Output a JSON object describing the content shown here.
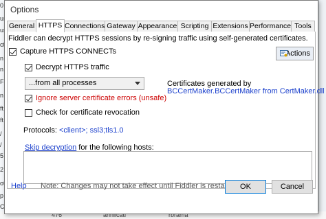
{
  "background": {
    "left_fragments": [
      "0",
      "us",
      "us",
      "ct",
      "n",
      "n",
      "Fu",
      "n",
      "ft",
      "ft",
      "/",
      "/",
      "5",
      "2",
      "ot",
      "p",
      "C"
    ],
    "bottom_fragments": [
      "",
      "476",
      "annlicati",
      "rbrama"
    ]
  },
  "window": {
    "title": "Options"
  },
  "tabs": [
    {
      "label": "General",
      "active": false
    },
    {
      "label": "HTTPS",
      "active": true
    },
    {
      "label": "Connections",
      "active": false
    },
    {
      "label": "Gateway",
      "active": false
    },
    {
      "label": "Appearance",
      "active": false
    },
    {
      "label": "Scripting",
      "active": false
    },
    {
      "label": "Extensions",
      "active": false
    },
    {
      "label": "Performance",
      "active": false
    },
    {
      "label": "Tools",
      "active": false
    }
  ],
  "https": {
    "description": "Fiddler can decrypt HTTPS sessions by re-signing traffic using self-generated certificates.",
    "capture_label": "Capture HTTPS CONNECTs",
    "capture_checked": true,
    "actions_label": "Actions",
    "decrypt_label": "Decrypt HTTPS traffic",
    "decrypt_checked": true,
    "process_filter": "...from all processes",
    "ignore_errors_label": "Ignore server certificate errors (unsafe)",
    "ignore_errors_checked": true,
    "revocation_label": "Check for certificate revocation",
    "revocation_checked": false,
    "cert_generated_label": "Certificates generated by",
    "cert_generator": "BCCertMaker.BCCertMaker from CertMaker.dll",
    "protocols_label": "Protocols:",
    "protocols_value": "<client>; ssl3;tls1.0",
    "skip_link": "Skip decryption",
    "skip_suffix": "for the following hosts:",
    "hosts_value": ""
  },
  "footer": {
    "help": "Help",
    "note": "Note: Changes may not take effect until Fiddler is restarted.",
    "ok": "OK",
    "cancel": "Cancel"
  },
  "colors": {
    "accent": "#0078d7",
    "link": "#1a3fcc",
    "warning": "#cc0000"
  }
}
